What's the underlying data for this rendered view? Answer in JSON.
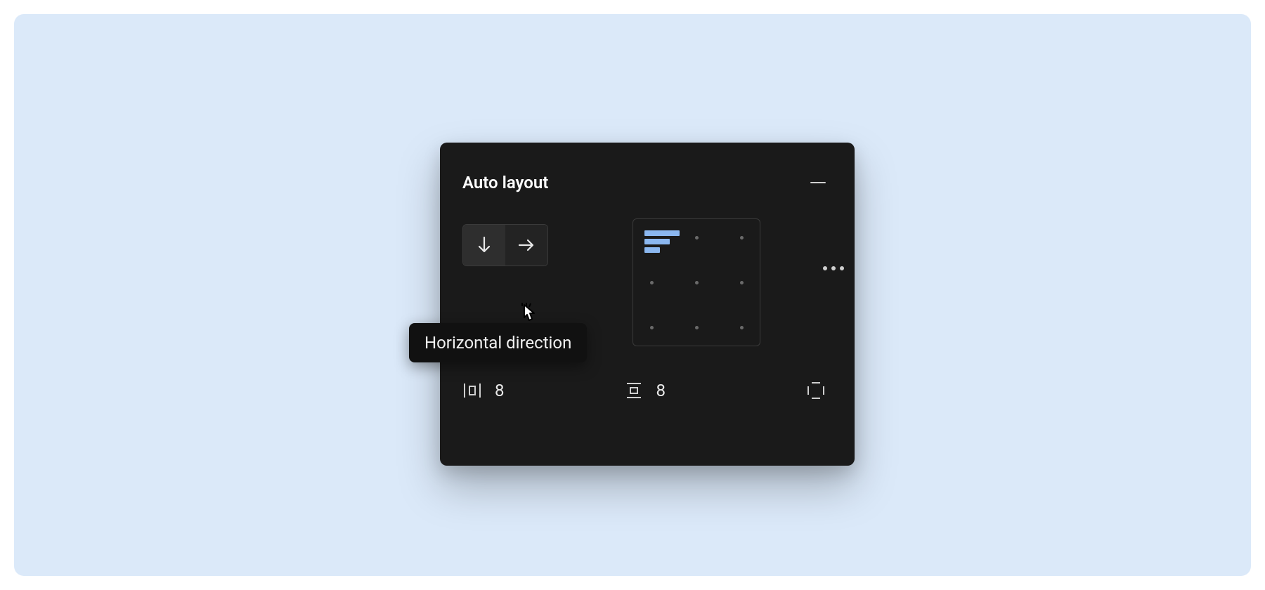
{
  "panel": {
    "title": "Auto layout",
    "direction": {
      "vertical_selected": true,
      "horizontal_hovered": true
    },
    "alignment": "top-left",
    "spacing_between": "8",
    "padding": "8"
  },
  "tooltip": {
    "text": "Horizontal direction"
  },
  "accent_color": "#8bb7ef"
}
